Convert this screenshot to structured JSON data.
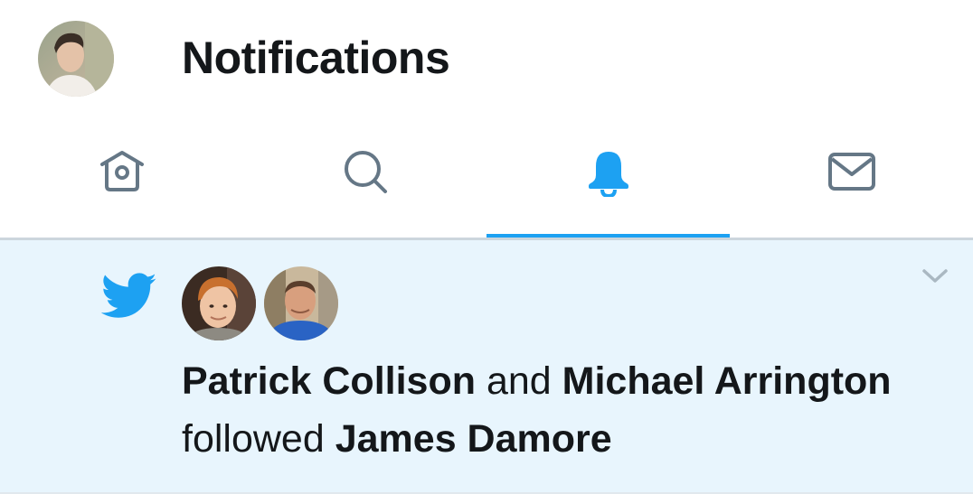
{
  "header": {
    "title": "Notifications",
    "profile_avatar": "user-avatar-photo"
  },
  "tabs": [
    {
      "label": "Home",
      "icon": "home-icon",
      "active": false
    },
    {
      "label": "Search",
      "icon": "search-icon",
      "active": false
    },
    {
      "label": "Notifications",
      "icon": "bell-icon",
      "active": true
    },
    {
      "label": "Messages",
      "icon": "envelope-icon",
      "active": false
    }
  ],
  "notification": {
    "type_icon": "twitter-bird-icon",
    "actors": [
      {
        "name": "Patrick Collison",
        "avatar": "patrick-collison-avatar"
      },
      {
        "name": "Michael Arrington",
        "avatar": "michael-arrington-avatar"
      }
    ],
    "conjunction": "and",
    "action": "followed",
    "target": "James Damore",
    "menu_icon": "chevron-down-icon"
  },
  "colors": {
    "accent": "#1da1f2",
    "icon_gray": "#657786",
    "notification_bg": "#e8f5fd",
    "text": "#14171a"
  }
}
